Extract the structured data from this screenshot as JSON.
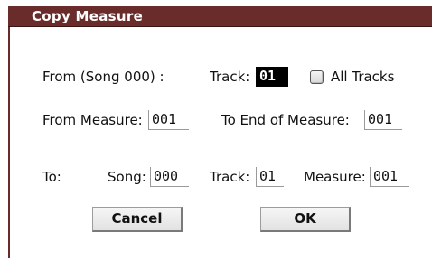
{
  "dialog": {
    "title": "Copy Measure"
  },
  "from": {
    "label": "From (Song 000) :",
    "track_label": "Track:",
    "track_value": "01",
    "all_tracks_label": "All Tracks",
    "all_tracks_checked": false,
    "measure_label": "From Measure:",
    "measure_value": "001",
    "end_measure_label": "To End of Measure:",
    "end_measure_value": "001"
  },
  "to": {
    "label": "To:",
    "song_label": "Song:",
    "song_value": "000",
    "track_label": "Track:",
    "track_value": "01",
    "measure_label": "Measure:",
    "measure_value": "001"
  },
  "buttons": {
    "cancel_label": "Cancel",
    "ok_label": "OK"
  },
  "colors": {
    "titlebar": "#6a2b2b",
    "selected_field_bg": "#000000",
    "selected_field_fg": "#ffffff"
  }
}
